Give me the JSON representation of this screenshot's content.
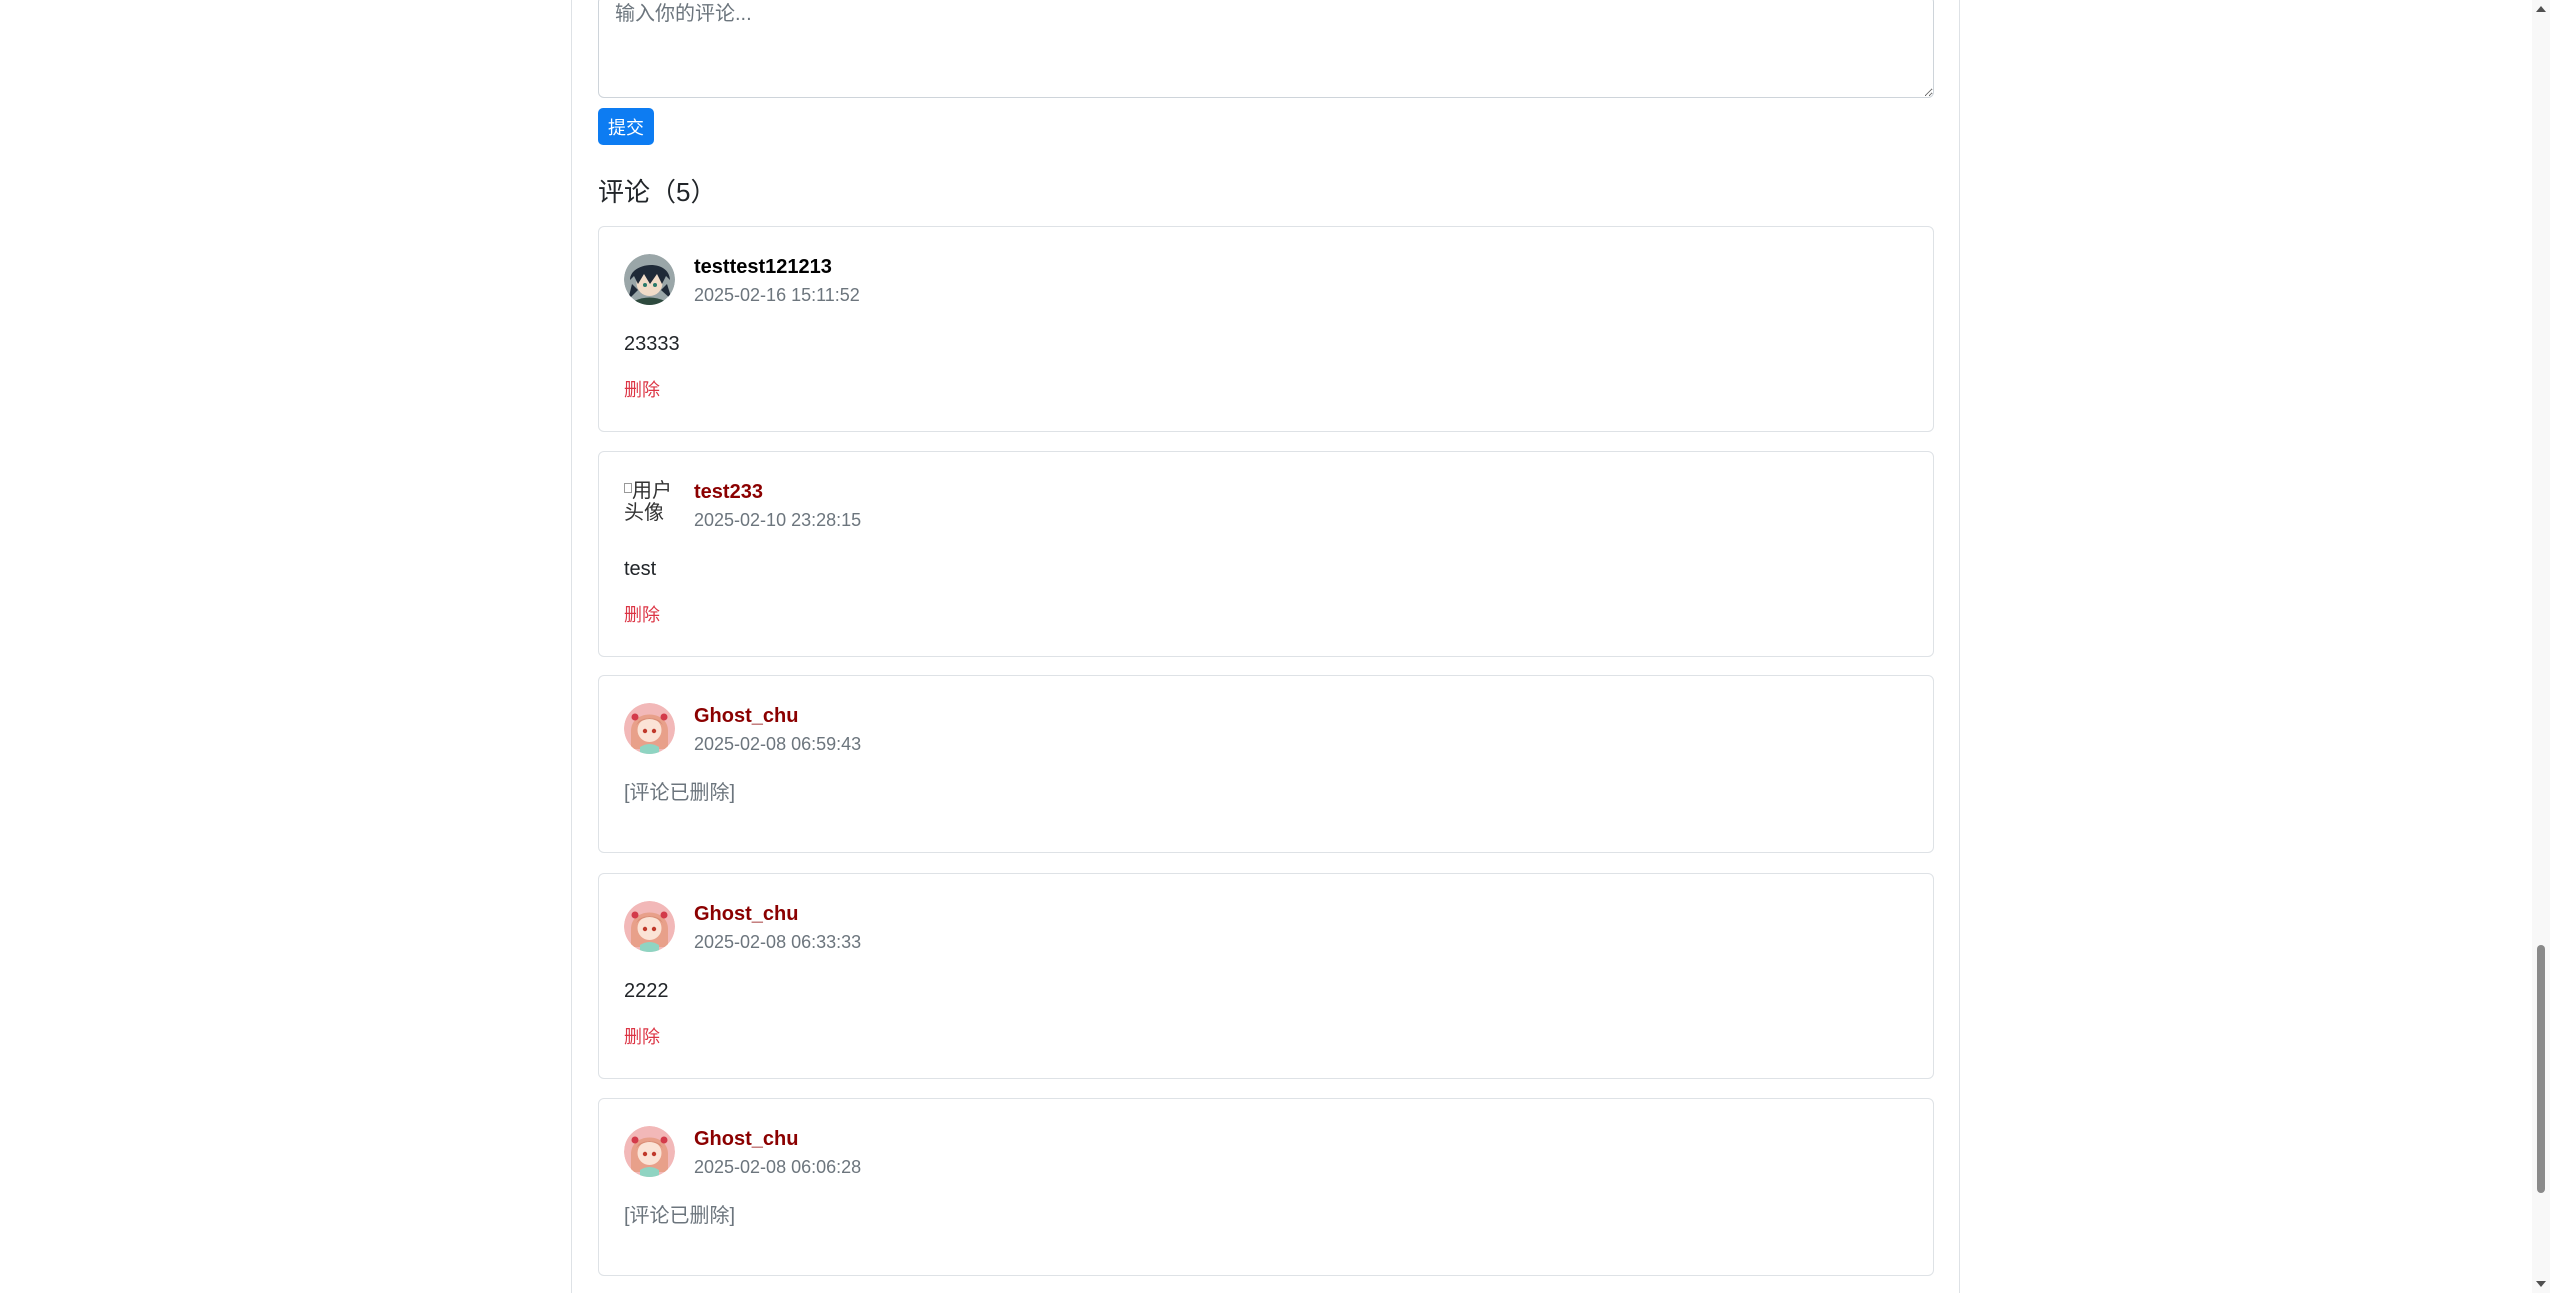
{
  "comment_form": {
    "placeholder": "输入你的评论...",
    "submit_label": "提交"
  },
  "comments_heading": "评论（5）",
  "comments": [
    {
      "username": "testtest121213",
      "timestamp": "2025-02-16 15:11:52",
      "body": "23333",
      "delete_label": "删除",
      "name_color": "#000000",
      "deleted": false,
      "avatar": "dark-hair-character"
    },
    {
      "username": "test233",
      "timestamp": "2025-02-10 23:28:15",
      "body": "test",
      "delete_label": "删除",
      "name_color": "#8b0000",
      "deleted": false,
      "avatar": "broken-image",
      "avatar_alt": "用户头像"
    },
    {
      "username": "Ghost_chu",
      "timestamp": "2025-02-08 06:59:43",
      "body": "[评论已删除]",
      "name_color": "#8b0000",
      "deleted": true,
      "avatar": "pink-hair-character"
    },
    {
      "username": "Ghost_chu",
      "timestamp": "2025-02-08 06:33:33",
      "body": "2222",
      "delete_label": "删除",
      "name_color": "#8b0000",
      "deleted": false,
      "avatar": "pink-hair-character"
    },
    {
      "username": "Ghost_chu",
      "timestamp": "2025-02-08 06:06:28",
      "body": "[评论已删除]",
      "name_color": "#8b0000",
      "deleted": true,
      "avatar": "pink-hair-character"
    }
  ],
  "colors": {
    "primary": "#0d7cf2",
    "danger": "#dc3545",
    "muted": "#6c757d",
    "username_admin": "#8b0000"
  }
}
